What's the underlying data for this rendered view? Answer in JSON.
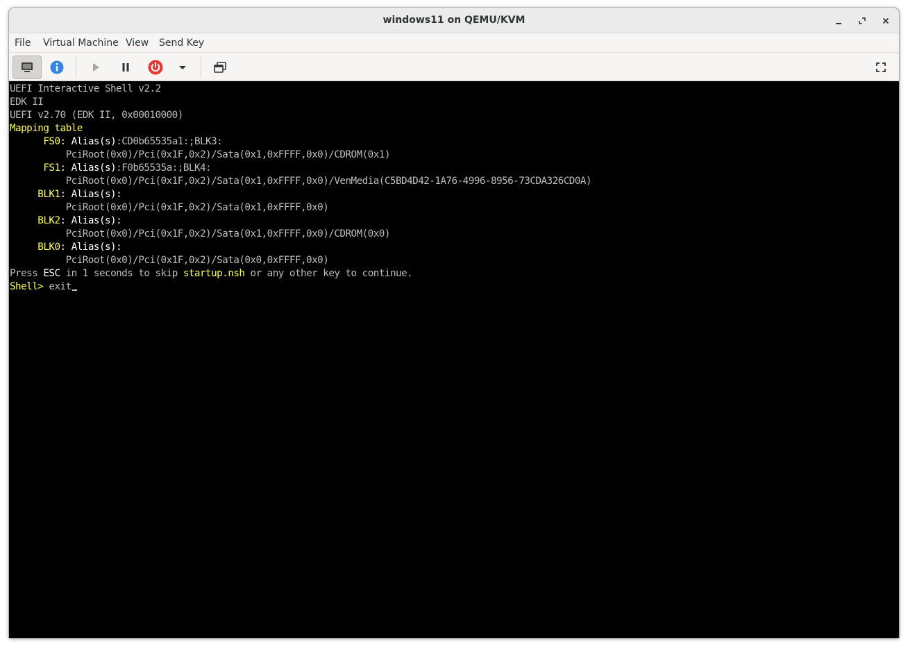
{
  "window": {
    "title": "windows11 on QEMU/KVM",
    "controls": [
      "minimize-icon",
      "restore-icon",
      "close-icon"
    ]
  },
  "menu": {
    "file": "File",
    "virtual_machine": "Virtual Machine",
    "view": "View",
    "send_key": "Send Key"
  },
  "toolbar": {
    "buttons": [
      "console-icon",
      "info-icon",
      "play-icon",
      "pause-icon",
      "power-icon",
      "dropdown-icon",
      "snapshot-icon",
      "fullscreen-icon"
    ],
    "power_color": "#e53935",
    "info_color": "#3584e4"
  },
  "console": {
    "l1": "UEFI Interactive Shell v2.2",
    "l2": "EDK II",
    "l3": "UEFI v2.70 (EDK II, 0x00010000)",
    "l4": "Mapping table",
    "fs0": {
      "name": "FS0",
      "sep": ":",
      "alias_label": " Alias(s)",
      "alias_value": ":CD0b65535a1:;BLK3:",
      "path": "PciRoot(0x0)/Pci(0x1F,0x2)/Sata(0x1,0xFFFF,0x0)/CDROM(0x1)"
    },
    "fs1": {
      "name": "FS1",
      "sep": ":",
      "alias_label": " Alias(s)",
      "alias_value": ":F0b65535a:;BLK4:",
      "path": "PciRoot(0x0)/Pci(0x1F,0x2)/Sata(0x1,0xFFFF,0x0)/VenMedia(C5BD4D42-1A76-4996-8956-73CDA326CD0A)"
    },
    "blk1": {
      "name": "BLK1",
      "sep": ":",
      "alias_label": " Alias(s)",
      "alias_value": ":",
      "path": "PciRoot(0x0)/Pci(0x1F,0x2)/Sata(0x1,0xFFFF,0x0)"
    },
    "blk2": {
      "name": "BLK2",
      "sep": ":",
      "alias_label": " Alias(s)",
      "alias_value": ":",
      "path": "PciRoot(0x0)/Pci(0x1F,0x2)/Sata(0x1,0xFFFF,0x0)/CDROM(0x0)"
    },
    "blk0": {
      "name": "BLK0",
      "sep": ":",
      "alias_label": " Alias(s)",
      "alias_value": ":",
      "path": "PciRoot(0x0)/Pci(0x1F,0x2)/Sata(0x0,0xFFFF,0x0)"
    },
    "press": {
      "a": "Press ",
      "esc": "ESC",
      "b": " in 1 seconds to skip ",
      "file": "startup.nsh",
      "c": " or any other key to continue."
    },
    "prompt": "Shell>",
    "command": " exit"
  },
  "colors": {
    "console_bg": "#000000",
    "console_text": "#bdbdbd",
    "highlight_yellow": "#ffff55",
    "bright_white": "#ffffff"
  }
}
